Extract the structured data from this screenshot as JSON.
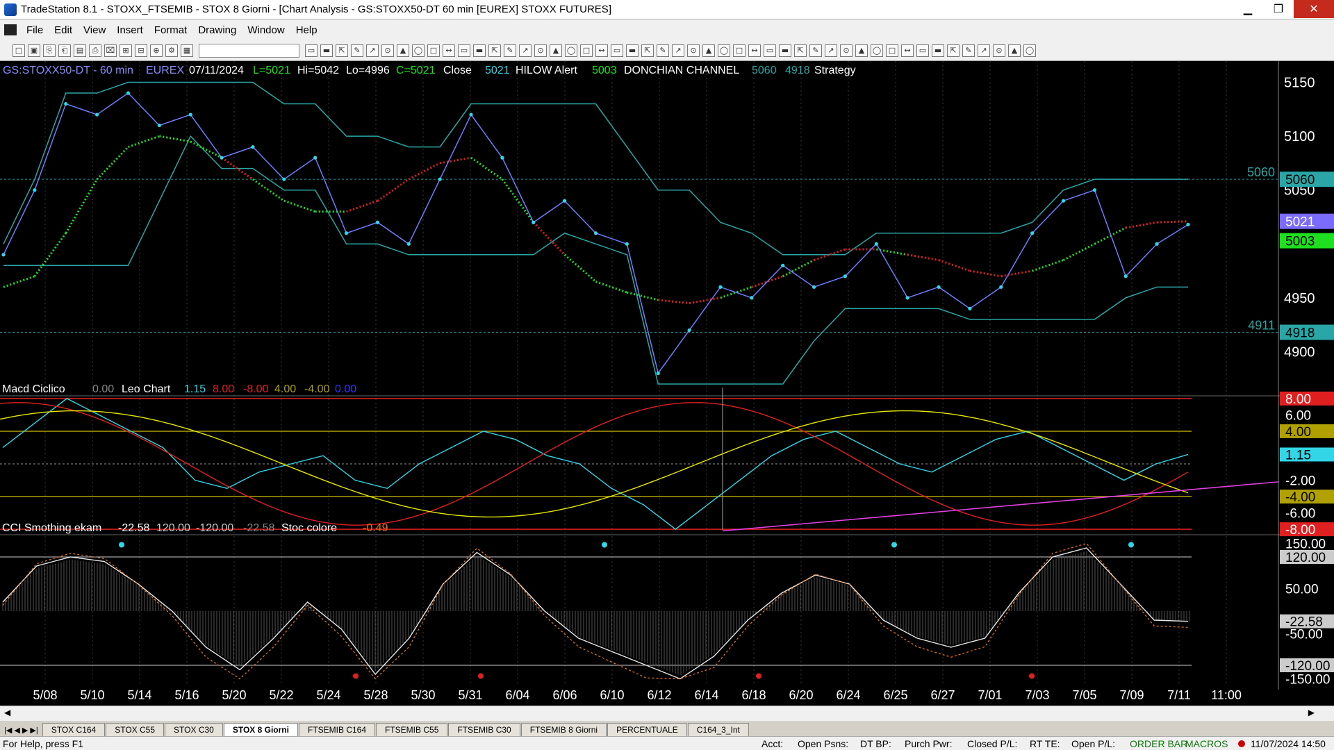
{
  "window": {
    "title": "TradeStation 8.1 - STOXX_FTSEMIB - STOX  8 Giorni - [Chart Analysis - GS:STOXX50-DT  60 min  [EUREX] STOXX FUTURES]",
    "minimize": "▁",
    "maximize": "❐",
    "close": "✕"
  },
  "menu": [
    "File",
    "Edit",
    "View",
    "Insert",
    "Format",
    "Drawing",
    "Window",
    "Help"
  ],
  "price_panel": {
    "symbol": "GS:STOXX50-DT - 60 min",
    "exchange": "EUREX",
    "date": "07/11/2024",
    "low_label": "L=5021",
    "hi_label": "Hi=5042",
    "lo_label": "Lo=4996",
    "close_label": "C=5021",
    "close_word": "Close",
    "close_val": "5021",
    "hilow": "HILOW Alert",
    "hilow_val": "5003",
    "donchian": "DONCHIAN CHANNEL",
    "don_hi": "5060",
    "don_lo": "4918",
    "strategy": "Strategy",
    "axis_labels": [
      "5150",
      "5100",
      "5050",
      "4950",
      "4900"
    ],
    "badge_5060": "5060",
    "badge_5021": "5021",
    "badge_5003": "5003",
    "badge_4918": "4918",
    "left_5060": "5060",
    "left_4911": "4911"
  },
  "macd_panel": {
    "name": "Macd Ciclico",
    "v0": "0.00",
    "leo": "Leo Chart",
    "v1": "1.15",
    "v2": "8.00",
    "v3": "-8.00",
    "v4": "4.00",
    "v5": "-4.00",
    "v6": "0.00",
    "axis": [
      "8.00",
      "6.00",
      "4.00",
      "1.15",
      "-2.00",
      "-4.00",
      "-6.00",
      "-8.00"
    ]
  },
  "cci_panel": {
    "name": "CCI Smothing ekam",
    "v1": "-22.58",
    "v2": "120.00",
    "v3": "-120.00",
    "v4": "-22.58",
    "stoc": "Stoc colore",
    "stoc_val": "-0.49",
    "axis": [
      "150.00",
      "120.00",
      "50.00",
      "-22.58",
      "-50.00",
      "-120.00",
      "-150.00"
    ]
  },
  "x_axis": [
    "5/08",
    "5/10",
    "5/14",
    "5/16",
    "5/20",
    "5/22",
    "5/24",
    "5/28",
    "5/30",
    "5/31",
    "6/04",
    "6/06",
    "6/10",
    "6/12",
    "6/14",
    "6/18",
    "6/20",
    "6/24",
    "6/25",
    "6/27",
    "7/01",
    "7/03",
    "7/05",
    "7/09",
    "7/11",
    "11:00"
  ],
  "tabs": [
    "STOX C164",
    "STOX C55",
    "STOX  C30",
    "STOX  8 Giorni",
    "FTSEMIB C164",
    "FTSEMIB C55",
    "FTSEMIB C30",
    "FTSEMIB  8 Giorni",
    "PERCENTUALE",
    "C164_3_Int"
  ],
  "active_tab": 3,
  "status": {
    "help": "For Help, press F1",
    "acct": "Acct:",
    "open_psns": "Open Psns:",
    "dt_bp": "DT BP:",
    "purch_pwr": "Purch Pwr:",
    "closed_pl": "Closed P/L:",
    "rt_te": "RT TE:",
    "open_pl": "Open P/L:",
    "order_bar": "ORDER BAR",
    "macros": "MACROS",
    "datetime": "11/07/2024 14:50"
  },
  "colors": {
    "price": "#33d6e6",
    "red": "#e02020",
    "green": "#1ee01e",
    "yellow": "#e6e600",
    "magenta": "#e040e0",
    "channel": "#2aa6a6"
  },
  "chart_data": [
    {
      "type": "line",
      "title": "GS:STOXX50-DT - 60 min",
      "ylim": [
        4870,
        5160
      ],
      "x_ticks": [
        "5/08",
        "5/10",
        "5/14",
        "5/16",
        "5/20",
        "5/22",
        "5/24",
        "5/28",
        "5/30",
        "5/31",
        "6/04",
        "6/06",
        "6/10",
        "6/12",
        "6/14",
        "6/18",
        "6/20",
        "6/24",
        "6/25",
        "6/27",
        "7/01",
        "7/03",
        "7/05",
        "7/09",
        "7/11"
      ],
      "series": [
        {
          "name": "Close",
          "values": [
            4990,
            5050,
            5130,
            5120,
            5140,
            5110,
            5120,
            5080,
            5090,
            5060,
            5080,
            5010,
            5020,
            5000,
            5060,
            5120,
            5080,
            5020,
            5040,
            5010,
            5000,
            4880,
            4920,
            4960,
            4950,
            4980,
            4960,
            4970,
            5000,
            4950,
            4960,
            4940,
            4960,
            5010,
            5040,
            5050,
            4970,
            5000,
            5018
          ]
        },
        {
          "name": "HILOW Alert",
          "values": [
            4960,
            4970,
            5010,
            5060,
            5090,
            5100,
            5095,
            5080,
            5060,
            5040,
            5030,
            5030,
            5040,
            5060,
            5075,
            5080,
            5060,
            5020,
            4990,
            4965,
            4955,
            4948,
            4945,
            4950,
            4960,
            4970,
            4985,
            4995,
            4995,
            4990,
            4985,
            4975,
            4970,
            4975,
            4985,
            5000,
            5015,
            5020,
            5021
          ]
        },
        {
          "name": "DONCHIAN CHANNEL",
          "hi": 5060,
          "lo": 4918
        }
      ]
    },
    {
      "type": "line",
      "title": "Macd Ciclico",
      "ylim": [
        -8.5,
        8.5
      ],
      "hlines": [
        8,
        4,
        0,
        -4,
        -8
      ],
      "series": [
        {
          "name": "Leo Chart",
          "values": [
            2,
            5,
            8,
            6,
            4,
            2,
            -2,
            -3,
            -1,
            0,
            1,
            -2,
            -3,
            0,
            2,
            4,
            3,
            1,
            0,
            -3,
            -5,
            -8,
            -5,
            -2,
            1,
            3,
            4,
            2,
            0,
            -1,
            1,
            3,
            4,
            2,
            0,
            -2,
            0,
            1.15
          ]
        }
      ]
    },
    {
      "type": "line",
      "title": "CCI Smothing ekam",
      "ylim": [
        -160,
        160
      ],
      "hlines": [
        120,
        -120
      ],
      "series": [
        {
          "name": "CCI",
          "values": [
            20,
            100,
            120,
            110,
            60,
            0,
            -80,
            -130,
            -60,
            20,
            -40,
            -140,
            -60,
            60,
            130,
            80,
            0,
            -60,
            -90,
            -120,
            -150,
            -100,
            -20,
            40,
            80,
            60,
            -20,
            -60,
            -80,
            -60,
            40,
            120,
            140,
            60,
            -20,
            -22.58
          ]
        }
      ]
    }
  ]
}
